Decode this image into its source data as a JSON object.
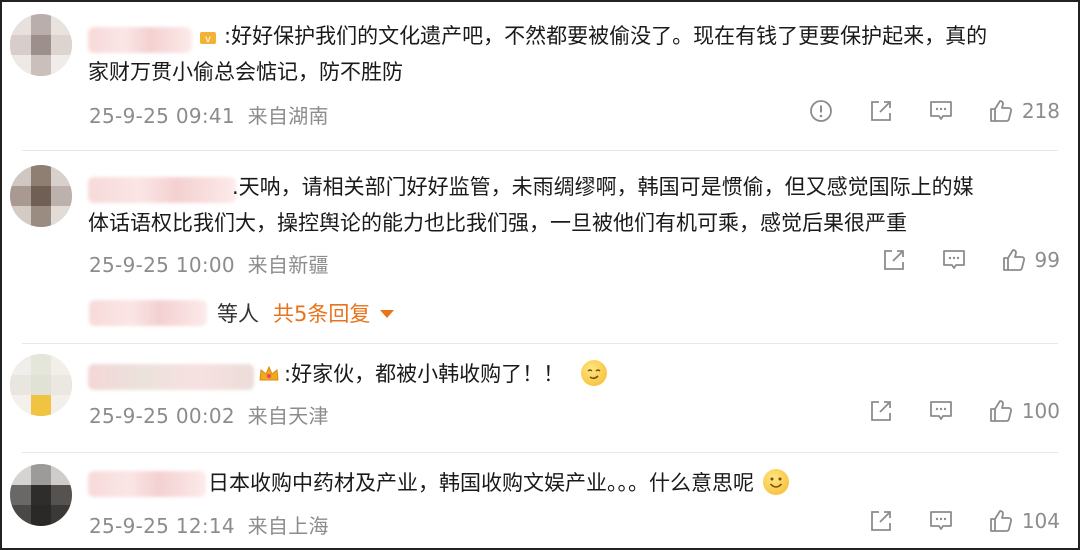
{
  "comments": [
    {
      "text_line1": ":好好保护我们的文化遗产吧，不然都要被偷没了。现在有钱了更要保护起来，真的",
      "text_line2": "家财万贯小偷总会惦记，防不胜防",
      "time": "25-9-25 09:41",
      "location": "来自湖南",
      "likes": "218",
      "has_report": true
    },
    {
      "text_line1": ".天呐，请相关部门好好监管，未雨绸缪啊，韩国可是惯偷，但又感觉国际上的媒",
      "text_line2": "体话语权比我们大，操控舆论的能力也比我们强，一旦被他们有机可乘，感觉后果很严重",
      "time": "25-9-25 10:00",
      "location": "来自新疆",
      "likes": "99",
      "replies_suffix": "等人",
      "replies_count": "共5条回复"
    },
    {
      "text_line1": ":好家伙，都被小韩收购了！！",
      "time": "25-9-25 00:02",
      "location": "来自天津",
      "likes": "100"
    },
    {
      "text_line1": "日本收购中药材及产业，韩国收购文娱产业。。。什么意思呢",
      "time": "25-9-25 12:14",
      "location": "来自上海",
      "likes": "104"
    }
  ],
  "icons": {
    "report": "report-icon",
    "share": "share-icon",
    "comment": "comment-icon",
    "like": "thumbs-up-icon",
    "caret": "caret-down-icon",
    "emoji": "smile-emoji-icon"
  },
  "colors": {
    "accent_orange": "#e8731c",
    "meta_gray": "#8c8c8c",
    "text": "#1a1a1a"
  }
}
